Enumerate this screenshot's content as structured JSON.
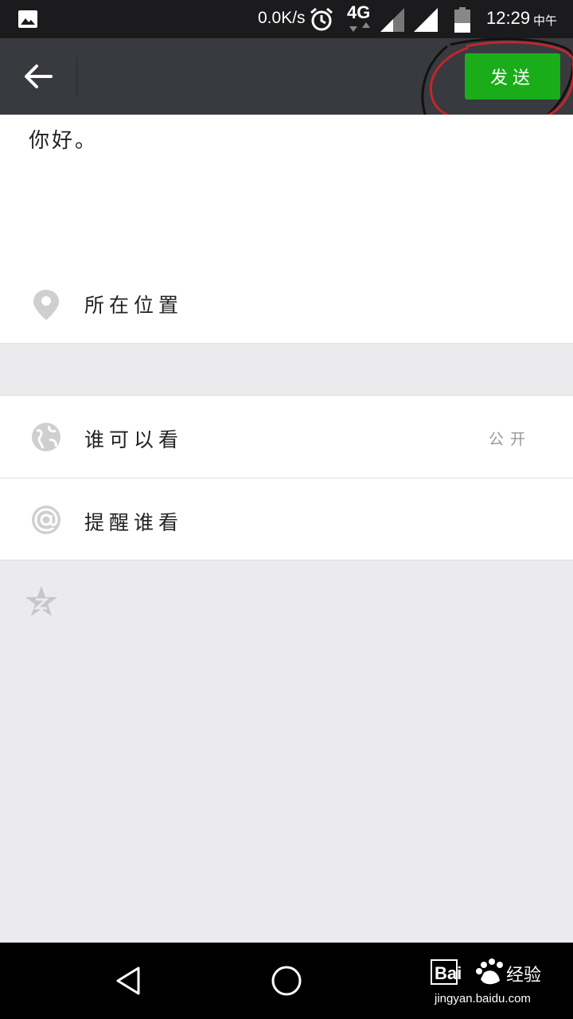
{
  "status_bar": {
    "net_speed": "0.0K/s",
    "network_type": "4G",
    "time": "12:29",
    "ampm": "中午",
    "icons": [
      "gallery-icon",
      "alarm-icon",
      "data-arrows-icon",
      "signal-icon",
      "signal-icon",
      "battery-icon"
    ]
  },
  "toolbar": {
    "back_icon": "arrow-left-icon",
    "send_label": "发送",
    "send_color": "#1aad19"
  },
  "post": {
    "text": "你好。"
  },
  "location": {
    "icon": "location-pin-icon",
    "label": "所在位置"
  },
  "privacy": {
    "icon": "globe-icon",
    "label": "谁可以看",
    "value": "公开"
  },
  "mention": {
    "icon": "at-sign-icon",
    "label": "提醒谁看"
  },
  "extra": {
    "icon": "qzone-star-icon"
  },
  "nav_bar": {
    "icons": [
      "triangle-back-icon",
      "circle-home-icon"
    ]
  },
  "watermark": {
    "site": "jingyan.baidu.com",
    "logo_text": "Bai 经验"
  }
}
